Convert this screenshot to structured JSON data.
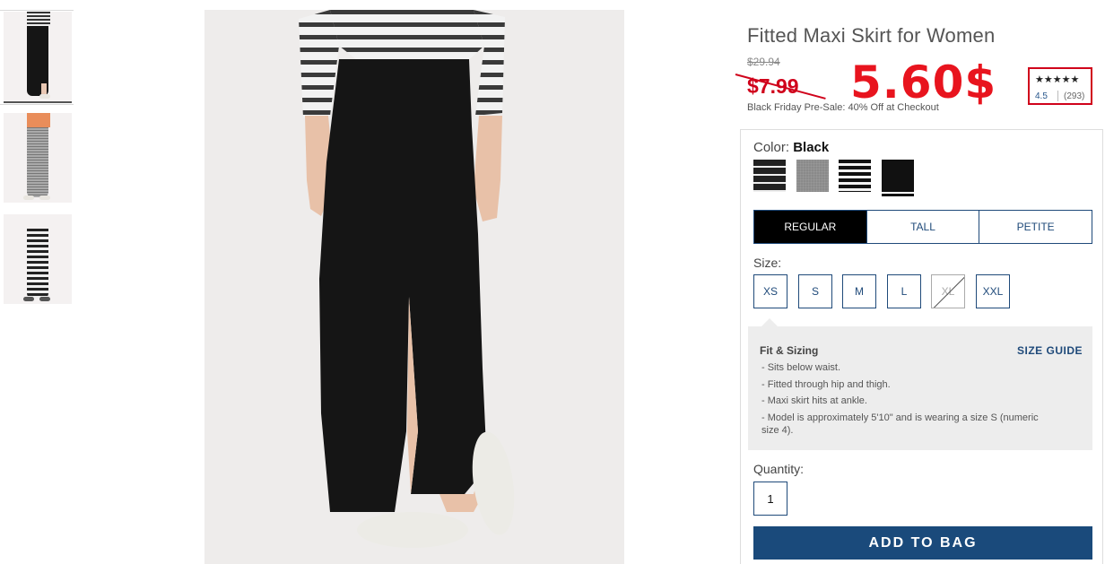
{
  "product": {
    "title": "Fitted Maxi Skirt for Women",
    "old_price": "$29.94",
    "current_price": "$7.99",
    "annotated_price": "5.60$",
    "promo": "Black Friday Pre-Sale: 40% Off at Checkout"
  },
  "rating": {
    "stars": "★★★★★",
    "value": "4.5",
    "count": "(293)"
  },
  "color": {
    "label": "Color:",
    "selected": "Black",
    "swatches": [
      "black-white-stripe",
      "heather-grey",
      "white-black-stripe",
      "black"
    ]
  },
  "fit_tabs": [
    "REGULAR",
    "TALL",
    "PETITE"
  ],
  "size": {
    "label": "Size:",
    "options": [
      "XS",
      "S",
      "M",
      "L",
      "XL",
      "XXL"
    ]
  },
  "fit_sizing": {
    "title": "Fit & Sizing",
    "guide_label": "SIZE GUIDE",
    "bullets": [
      "- Sits below waist.",
      "- Fitted through hip and thigh.",
      "- Maxi skirt hits at ankle.",
      "- Model is approximately 5'10\" and is wearing a size S (numeric size 4)."
    ]
  },
  "quantity": {
    "label": "Quantity:",
    "value": "1"
  },
  "add_to_bag": "ADD TO BAG",
  "colors": {
    "accent_blue": "#1a4a7b",
    "sale_red": "#d0021b"
  }
}
